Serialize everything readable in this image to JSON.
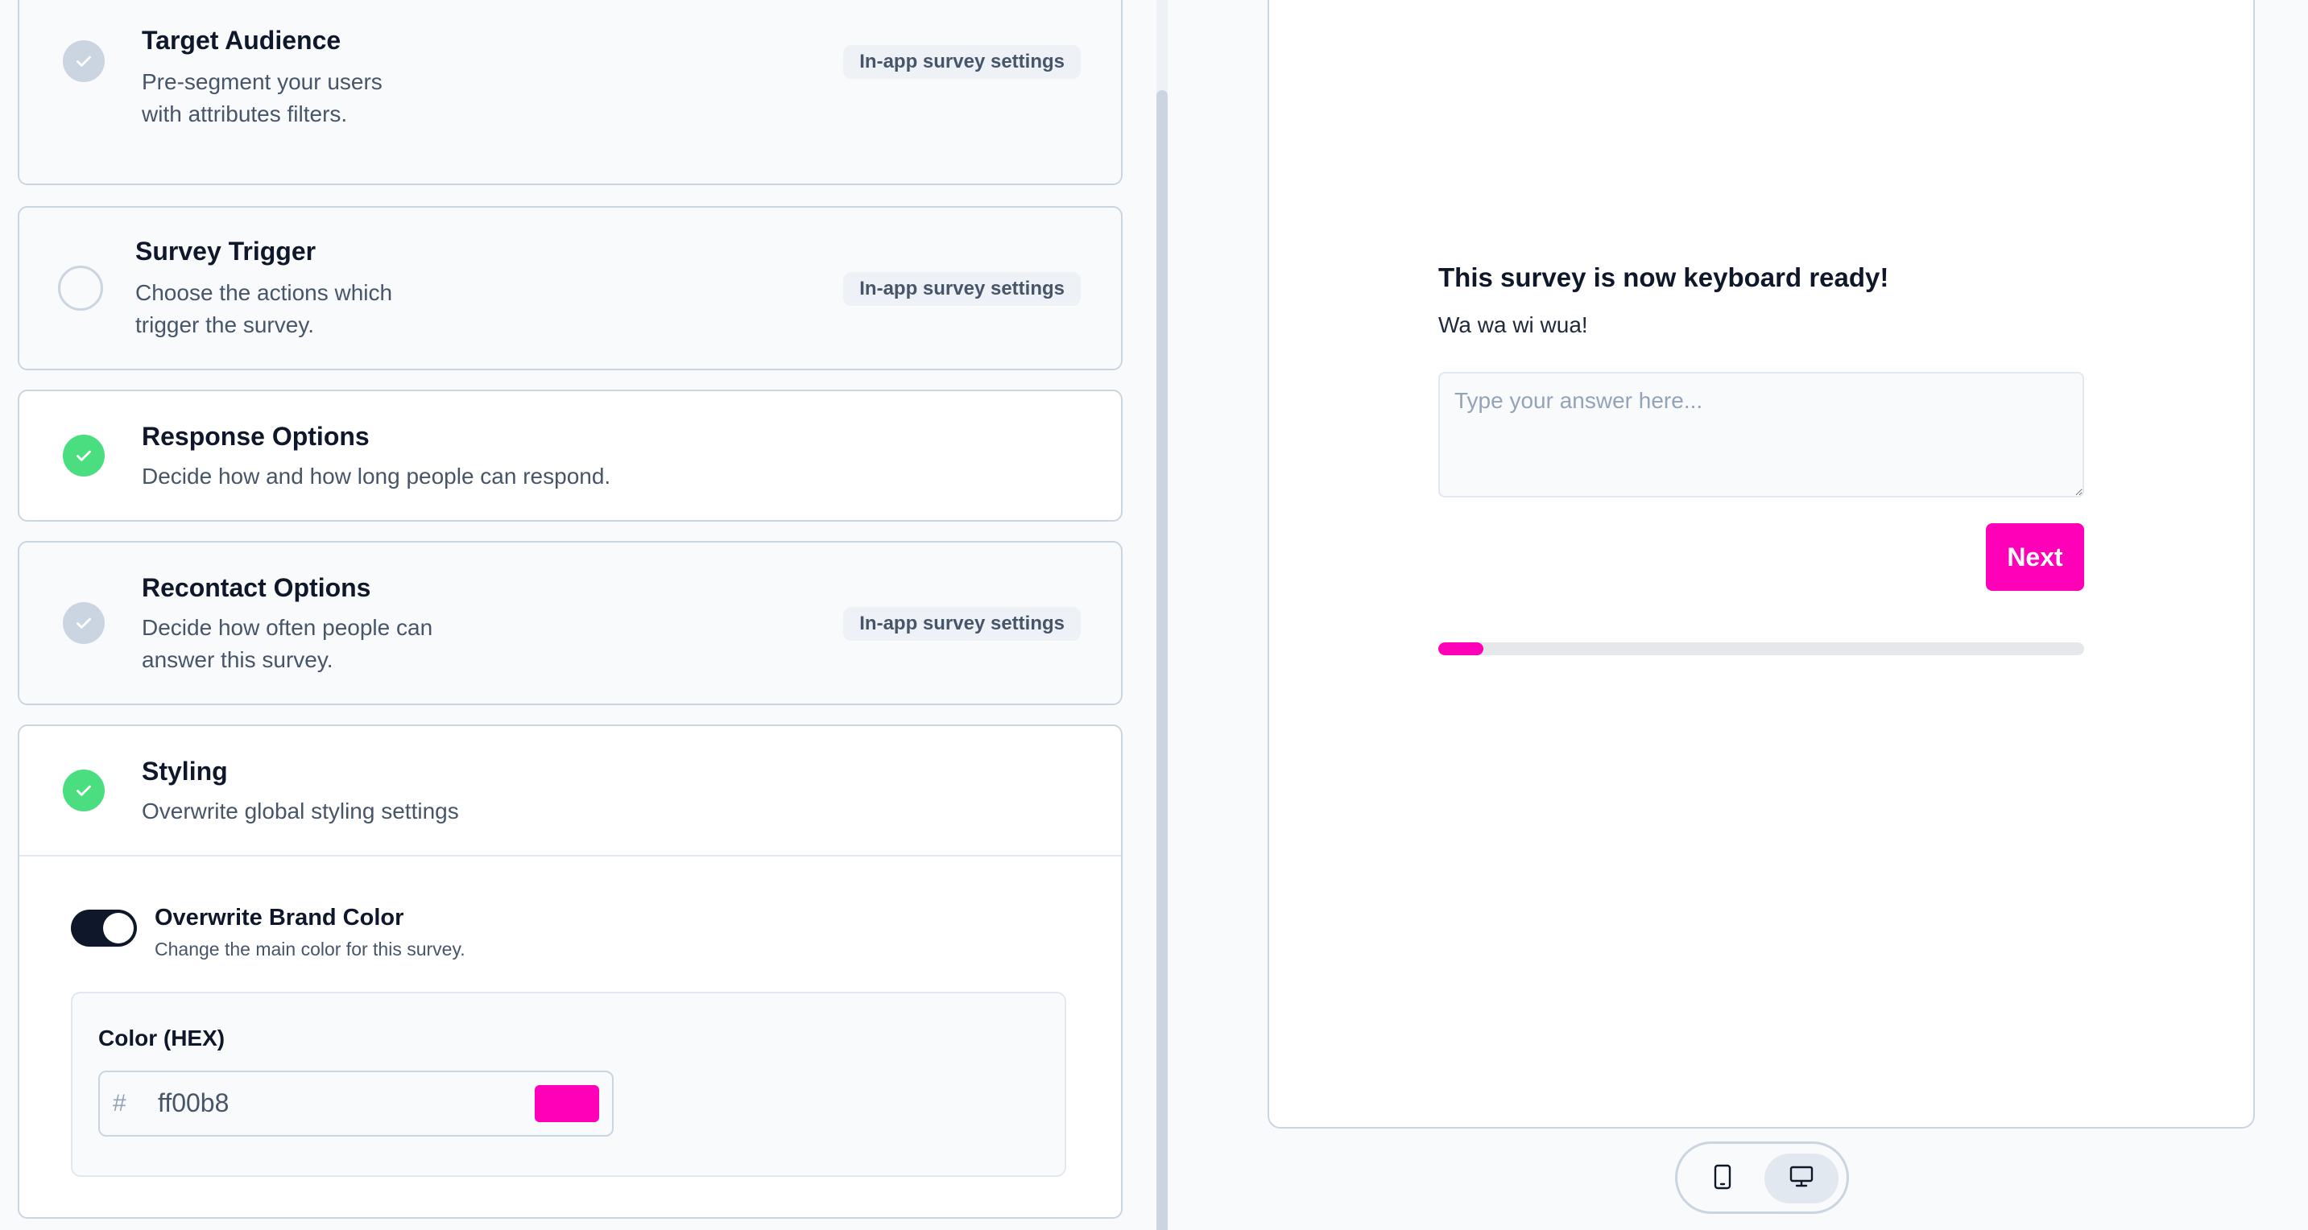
{
  "settings": {
    "target_audience": {
      "title": "Target Audience",
      "desc_line1": "Pre-segment your users",
      "desc_line2": "with attributes filters.",
      "badge": "In-app survey settings",
      "status": "done-disabled"
    },
    "survey_trigger": {
      "title": "Survey Trigger",
      "desc_line1": "Choose the actions which",
      "desc_line2": "trigger the survey.",
      "badge": "In-app survey settings",
      "status": "incomplete"
    },
    "response_options": {
      "title": "Response Options",
      "desc": "Decide how and how long people can respond.",
      "status": "done"
    },
    "recontact_options": {
      "title": "Recontact Options",
      "desc_line1": "Decide how often people can",
      "desc_line2": "answer this survey.",
      "badge": "In-app survey settings",
      "status": "done-disabled"
    },
    "styling": {
      "title": "Styling",
      "desc": "Overwrite global styling settings",
      "status": "done",
      "brand_toggle": {
        "title": "Overwrite Brand Color",
        "desc": "Change the main color for this survey.",
        "enabled": true
      },
      "color": {
        "label": "Color (HEX)",
        "prefix": "#",
        "value": "ff00b8",
        "swatch": "#ff00b8"
      }
    }
  },
  "preview": {
    "question_title": "This survey is now keyboard ready!",
    "question_subheader": "Wa wa wi wua!",
    "answer_placeholder": "Type your answer here...",
    "next_label": "Next",
    "progress_percent": 7,
    "brand_color": "#ff00b8"
  },
  "device_switch": {
    "options": [
      "mobile-icon",
      "desktop-icon"
    ],
    "active": "desktop-icon"
  }
}
